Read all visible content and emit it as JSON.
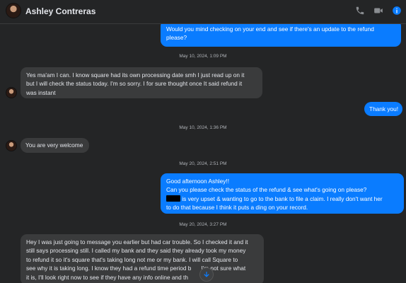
{
  "header": {
    "contact_name": "Ashley Contreras",
    "icons": [
      "phone-icon",
      "video-call-icon",
      "info-icon"
    ]
  },
  "messages": [
    {
      "direction": "outgoing",
      "lines": [
        "Would you mind checking on your end and see if there's an update to the refund",
        "please?"
      ]
    },
    {
      "timestamp": "May 10, 2024, 1:09 PM"
    },
    {
      "direction": "incoming",
      "lines": [
        "Yes ma'am I can. I know square had its own processing date smh I just read up on it",
        "but I will check the status today. I'm so sorry. I for sure thought once It said refund it",
        "was instant"
      ]
    },
    {
      "direction": "outgoing",
      "lines": [
        "Thank you!"
      ]
    },
    {
      "timestamp": "May 10, 2024, 1:36 PM"
    },
    {
      "direction": "incoming",
      "lines": [
        "You are very welcome"
      ]
    },
    {
      "timestamp": "May 20, 2024, 2:51 PM"
    },
    {
      "direction": "outgoing",
      "lines": [
        "Good afternoon Ashley!!",
        "Can you please check the status of the refund & see what's going on please?",
        "is very upset & wanting to go to the bank to file a claim. I really don't want her",
        "to do that because I think it puts a ding on your record."
      ]
    },
    {
      "timestamp": "May 20, 2024, 3:27 PM"
    },
    {
      "direction": "incoming",
      "lines": [
        "Hey I was just going to message you earlier but had car trouble. So I checked it and it",
        "still says processing still. I called my bank and they said they already took my money",
        "to refund it so it's square that's taking long not me or my bank. I will call Square to",
        "see why it is taking long. I know they had a refund time period b",
        "I'm not sure what",
        "it is, I'll look right now to see if they have any info online and th"
      ]
    }
  ],
  "colors": {
    "outgoing_bubble": "#0a7cff",
    "incoming_bubble": "#3a3b3c",
    "background": "#242526",
    "accent": "#0a7cff"
  }
}
